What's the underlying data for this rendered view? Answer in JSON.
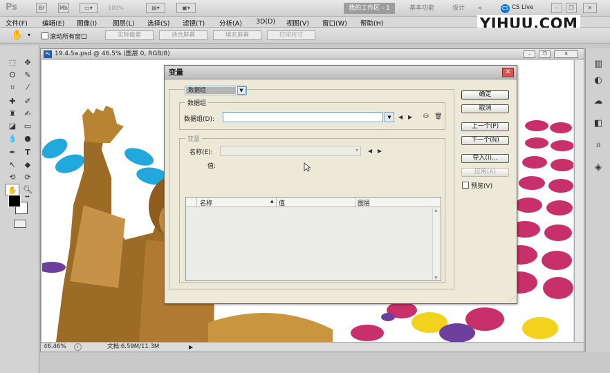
{
  "appbar": {
    "ps_logo": "Ps",
    "zoom": "100%",
    "workspace": "我的工作区 - 1",
    "essentials": "基本功能",
    "design": "设计",
    "more": "»",
    "cslive": "CS Live"
  },
  "menu": [
    "文件(F)",
    "编辑(E)",
    "图像(I)",
    "图层(L)",
    "选择(S)",
    "滤镜(T)",
    "分析(A)",
    "3D(D)",
    "视图(V)",
    "窗口(W)",
    "帮助(H)"
  ],
  "options": {
    "scroll_all": "滚动所有窗口",
    "actual_pixels": "实际像素",
    "fit_screen": "适合屏幕",
    "fill_screen": "填充屏幕",
    "print_size": "打印尺寸"
  },
  "watermark": "YIHUU.COM",
  "document": {
    "title": "19.4.5a.psd @ 46.5% (图层 0, RGB/8)",
    "zoom": "46.46%",
    "doc_info": "文档:6.59M/11.3M"
  },
  "dialog": {
    "title": "变量",
    "mode_select": "数据组",
    "dataset_group": "数据组",
    "dataset_label": "数据组(D):",
    "dataset_value": "",
    "variable_group": "变量",
    "name_label": "名称(E):",
    "value_label": "值:",
    "columns": [
      "名称",
      "值",
      "图层"
    ],
    "sort_indicator": "▲",
    "rows": [],
    "buttons": {
      "ok": "确定",
      "cancel": "取消",
      "prev": "上一个(P)",
      "next": "下一个(N)",
      "import": "导入(I)...",
      "apply": "应用(A)"
    },
    "preview": "预览(V)",
    "preview_checked": false
  },
  "colors": {
    "accent_pink": "#c8306a",
    "accent_cyan": "#22a8dd",
    "accent_yellow": "#f2d21c",
    "accent_purple": "#6e3f9d"
  }
}
